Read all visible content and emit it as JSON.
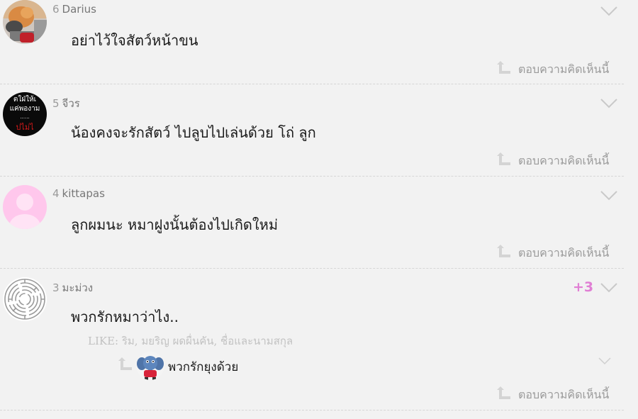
{
  "comments": [
    {
      "number": "6",
      "user": "Darius",
      "text": "อย่าไว้ใจสัตว์หน้าขน",
      "reply_label": "ตอบความคิดเห็นนี้",
      "avatar": "cat-photo-avatar"
    },
    {
      "number": "5",
      "user": "จีวร",
      "text": "น้องคงจะรักสัตว์ ไปลูบไปเล่นด้วย โถ่ ลูก",
      "reply_label": "ตอบความคิดเห็นนี้",
      "avatar": "text-image-avatar",
      "avatar_text": [
        "ตใฝ่ให้เ",
        "แค่พองาม",
        "......",
        "ปไม่ไ"
      ]
    },
    {
      "number": "4",
      "user": "kittapas",
      "text": "ลูกผมนะ หมาฝูงนั้นต้องไปเกิดใหม่",
      "reply_label": "ตอบความคิดเห็นนี้",
      "avatar": "default-pink-avatar"
    },
    {
      "number": "3",
      "user": "มะม่วง",
      "text": "พวกรักหมาว่าไง..",
      "score": "+3",
      "likes": "LIKE: ริม, มยริญ ผดผื่นคัน, ชื่อและนามสกุล",
      "reply_label": "ตอบความคิดเห็นนี้",
      "avatar": "maze-avatar",
      "subreply": {
        "text": "พวกรักยุงด้วย",
        "avatar": "elephant-avatar"
      }
    }
  ],
  "colors": {
    "background": "#f2f2f2",
    "score": "#e07fd4",
    "reply_text": "#9b9b9b",
    "meta_text": "#888888"
  }
}
